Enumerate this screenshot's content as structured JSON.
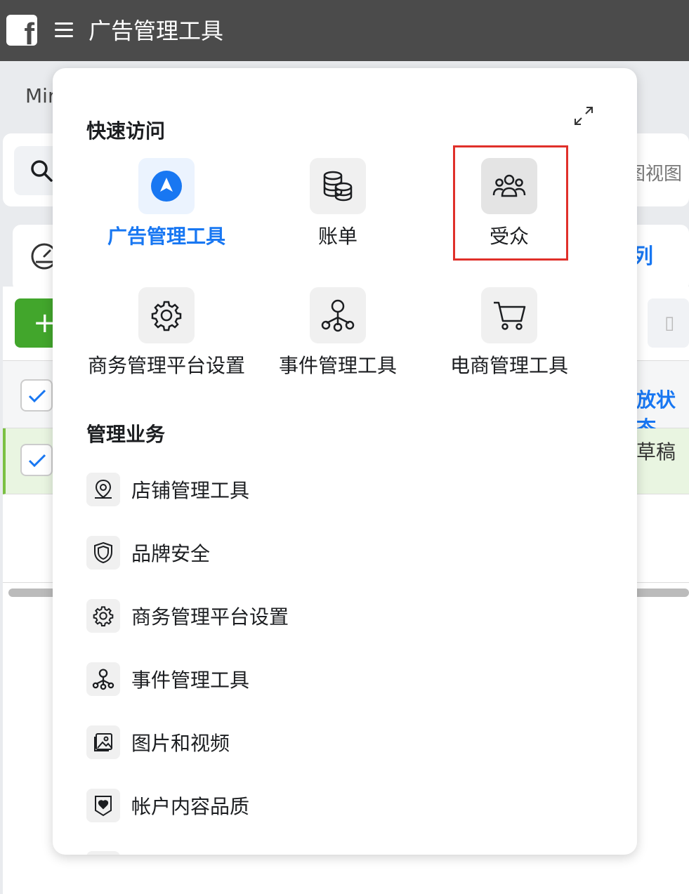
{
  "app": {
    "title": "广告管理工具"
  },
  "background": {
    "account_fragment": "Mir",
    "view_fragment": "图视图",
    "blue_fragment": "列",
    "status_header_fragment": "放状态",
    "row_status": "草稿"
  },
  "menu": {
    "quick_access_title": "快速访问",
    "quick_items": [
      {
        "label": "广告管理工具",
        "icon": "ads-manager-icon",
        "state": "active"
      },
      {
        "label": "账单",
        "icon": "billing-icon",
        "state": "normal"
      },
      {
        "label": "受众",
        "icon": "audiences-icon",
        "state": "highlighted"
      },
      {
        "label": "商务管理平台设置",
        "icon": "gear-icon",
        "state": "normal"
      },
      {
        "label": "事件管理工具",
        "icon": "events-manager-icon",
        "state": "normal"
      },
      {
        "label": "电商管理工具",
        "icon": "cart-icon",
        "state": "normal"
      }
    ],
    "manage_title": "管理业务",
    "manage_items": [
      {
        "label": "店铺管理工具",
        "icon": "location-pin-icon"
      },
      {
        "label": "品牌安全",
        "icon": "shield-icon"
      },
      {
        "label": "商务管理平台设置",
        "icon": "gear-icon"
      },
      {
        "label": "事件管理工具",
        "icon": "events-manager-icon"
      },
      {
        "label": "图片和视频",
        "icon": "media-icon"
      },
      {
        "label": "帐户内容品质",
        "icon": "account-quality-icon"
      }
    ]
  },
  "colors": {
    "topbar": "#4b4b4b",
    "accent_blue": "#1877f2",
    "highlight_red": "#e0302a",
    "create_green": "#42a62c"
  }
}
